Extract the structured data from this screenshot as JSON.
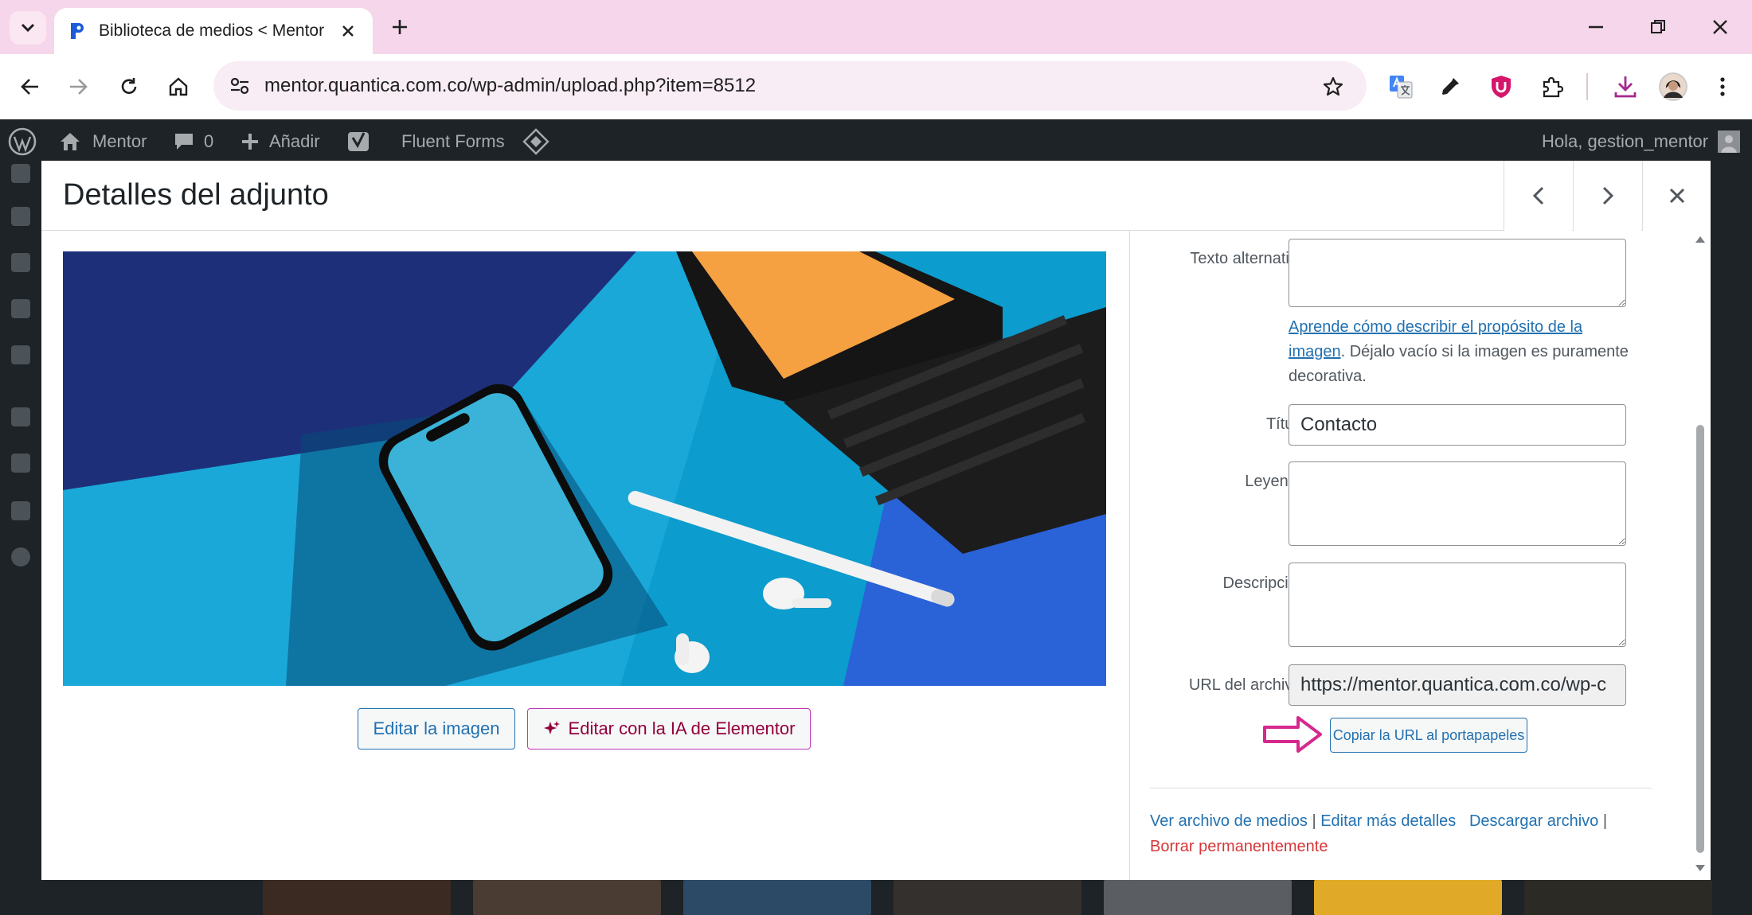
{
  "browser": {
    "tab_title": "Biblioteca de medios < Mentor",
    "url": "mentor.quantica.com.co/wp-admin/upload.php?item=8512"
  },
  "adminbar": {
    "site_name": "Mentor",
    "comments_count": "0",
    "new_label": "Añadir",
    "fluent_forms": "Fluent Forms",
    "greeting": "Hola, gestion_mentor"
  },
  "modal": {
    "title": "Detalles del adjunto",
    "edit_image_label": "Editar la imagen",
    "edit_ai_label": "Editar con la IA de Elementor"
  },
  "details": {
    "alt_label": "Texto alternativo",
    "alt_value": "",
    "alt_help_link": "Aprende cómo describir el propósito de la imagen",
    "alt_help_text": ". Déjalo vacío si la imagen es puramente decorativa.",
    "title_label": "Título",
    "title_value": "Contacto",
    "caption_label": "Leyenda",
    "caption_value": "",
    "description_label": "Descripción",
    "description_value": "",
    "file_url_label": "URL del archivo:",
    "file_url_value": "https://mentor.quantica.com.co/wp-c",
    "copy_url_label": "Copiar la URL al portapapeles"
  },
  "actions": {
    "view_media": "Ver archivo de medios",
    "edit_more": "Editar más detalles",
    "download": "Descargar archivo",
    "delete": "Borrar permanentemente",
    "separator": "|"
  },
  "colors": {
    "accent": "#2271b1",
    "danger": "#d63638",
    "ai": "#92003b",
    "arrow": "#d6298e",
    "tabstrip": "#f6d6ea"
  }
}
